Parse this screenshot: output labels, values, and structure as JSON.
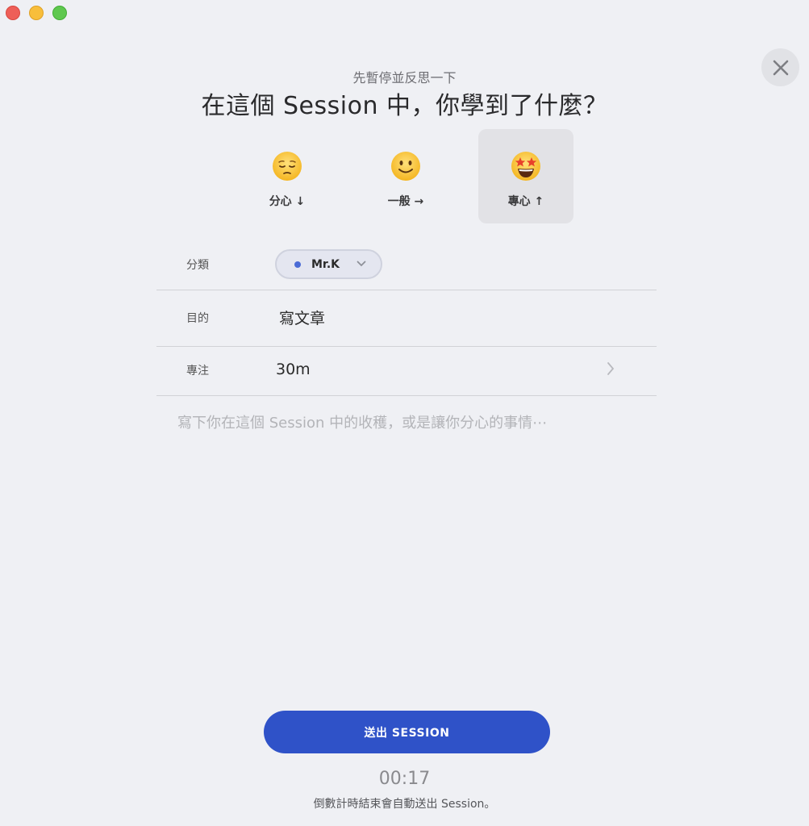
{
  "window": {
    "controls": [
      "close",
      "minimize",
      "maximize"
    ]
  },
  "header": {
    "subtitle": "先暫停並反思一下",
    "title": "在這個 Session 中，你學到了什麼？",
    "close_icon": "close-icon"
  },
  "moods": [
    {
      "label": "分心 ↓",
      "icon": "pensive-face-icon",
      "selected": false
    },
    {
      "label": "一般 →",
      "icon": "slightly-smiling-face-icon",
      "selected": false
    },
    {
      "label": "專心 ↑",
      "icon": "star-struck-face-icon",
      "selected": true
    }
  ],
  "form": {
    "category": {
      "label": "分類",
      "value": "Mr.K",
      "dot_color": "#4a6bd6"
    },
    "purpose": {
      "label": "目的",
      "value": "寫文章"
    },
    "focus": {
      "label": "專注",
      "value": "30m"
    },
    "notes": {
      "placeholder": "寫下你在這個 Session 中的收穫，或是讓你分心的事情⋯",
      "value": ""
    }
  },
  "footer": {
    "submit_label": "送出 SESSION",
    "timer": "00:17",
    "timer_note": "倒數計時結束會自動送出 Session。"
  },
  "colors": {
    "accent": "#2f52c8",
    "background": "#eff0f4"
  }
}
